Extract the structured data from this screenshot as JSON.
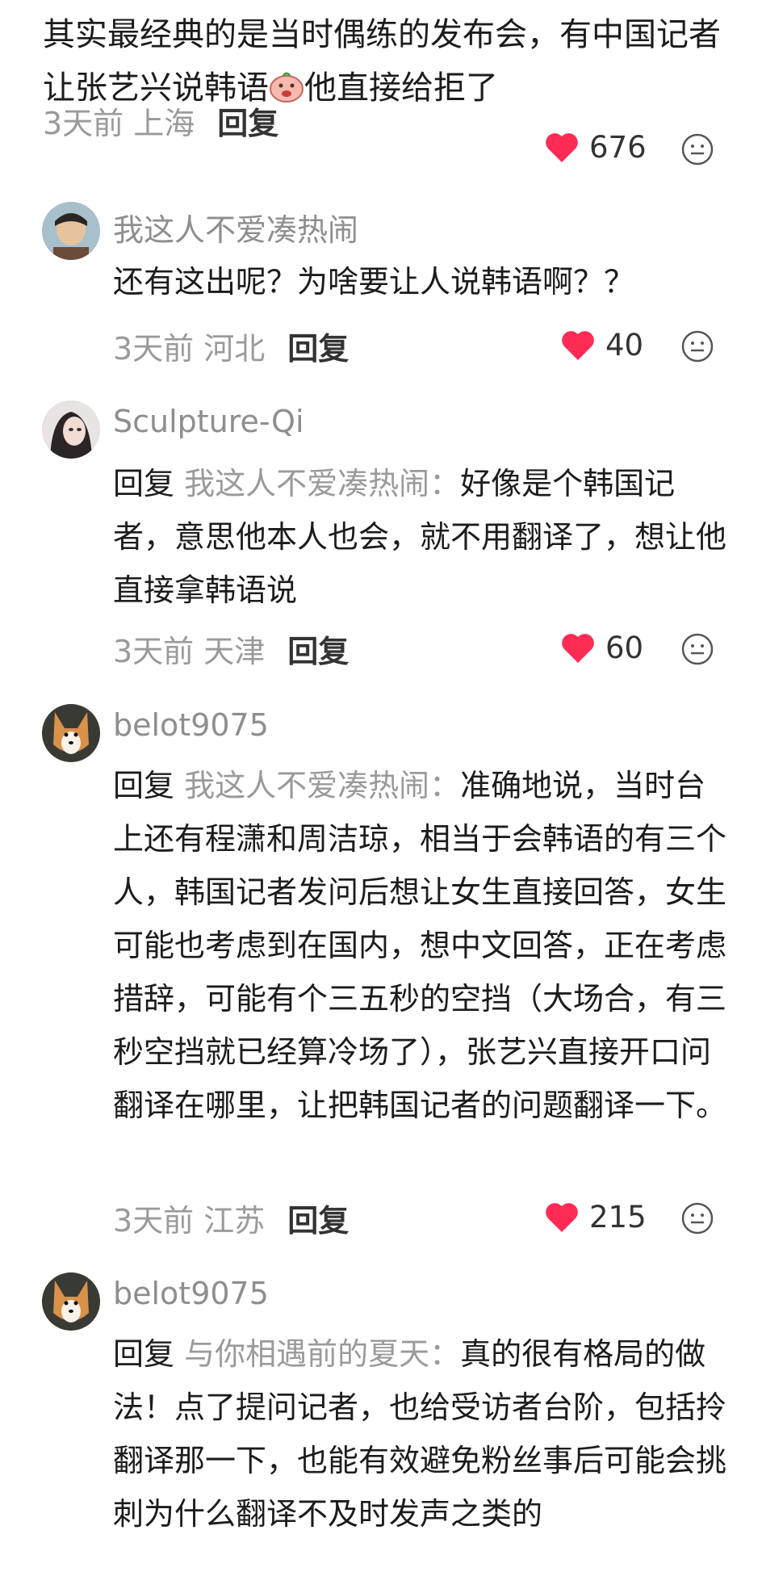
{
  "top_comment": {
    "text_before_emoji": "其实最经典的是当时偶练的发布会，有中国记者让张艺兴说韩语",
    "emoji": "face-emoji",
    "text_after_emoji": "他直接给拒了",
    "time_location": "3天前 上海",
    "reply_label": "回复",
    "likes": "676"
  },
  "replies": [
    {
      "username": "我这人不爱凑热闹",
      "text": "还有这出呢？为啥要让人说韩语啊？？",
      "time_location": "3天前 河北",
      "reply_label": "回复",
      "likes": "40"
    },
    {
      "username": "Sculpture-Qi",
      "reply_prefix": "回复",
      "reply_target": "我这人不爱凑热闹：",
      "text": "好像是个韩国记者，意思他本人也会，就不用翻译了，想让他直接拿韩语说",
      "time_location": "3天前 天津",
      "reply_label": "回复",
      "likes": "60"
    },
    {
      "username": "belot9075",
      "reply_prefix": "回复",
      "reply_target": "我这人不爱凑热闹：",
      "text": "准确地说，当时台上还有程潇和周洁琼，相当于会韩语的有三个人，韩国记者发问后想让女生直接回答，女生可能也考虑到在国内，想中文回答，正在考虑措辞，可能有个三五秒的空挡（大场合，有三秒空挡就已经算冷场了），张艺兴直接开口问翻译在哪里，让把韩国记者的问题翻译一下。",
      "time_location": "3天前 江苏",
      "reply_label": "回复",
      "likes": "215"
    },
    {
      "username": "belot9075",
      "reply_prefix": "回复",
      "reply_target": "与你相遇前的夏天：",
      "text": "真的很有格局的做法！点了提问记者，也给受访者台阶，包括拎翻译那一下，也能有效避免粉丝事后可能会挑刺为什么翻译不及时发声之类的"
    }
  ],
  "icons": {
    "like": "heart-icon",
    "more": "smile-face-icon"
  },
  "colors": {
    "heart": "#fe2c55",
    "meta_gray": "#9a9a9a"
  }
}
